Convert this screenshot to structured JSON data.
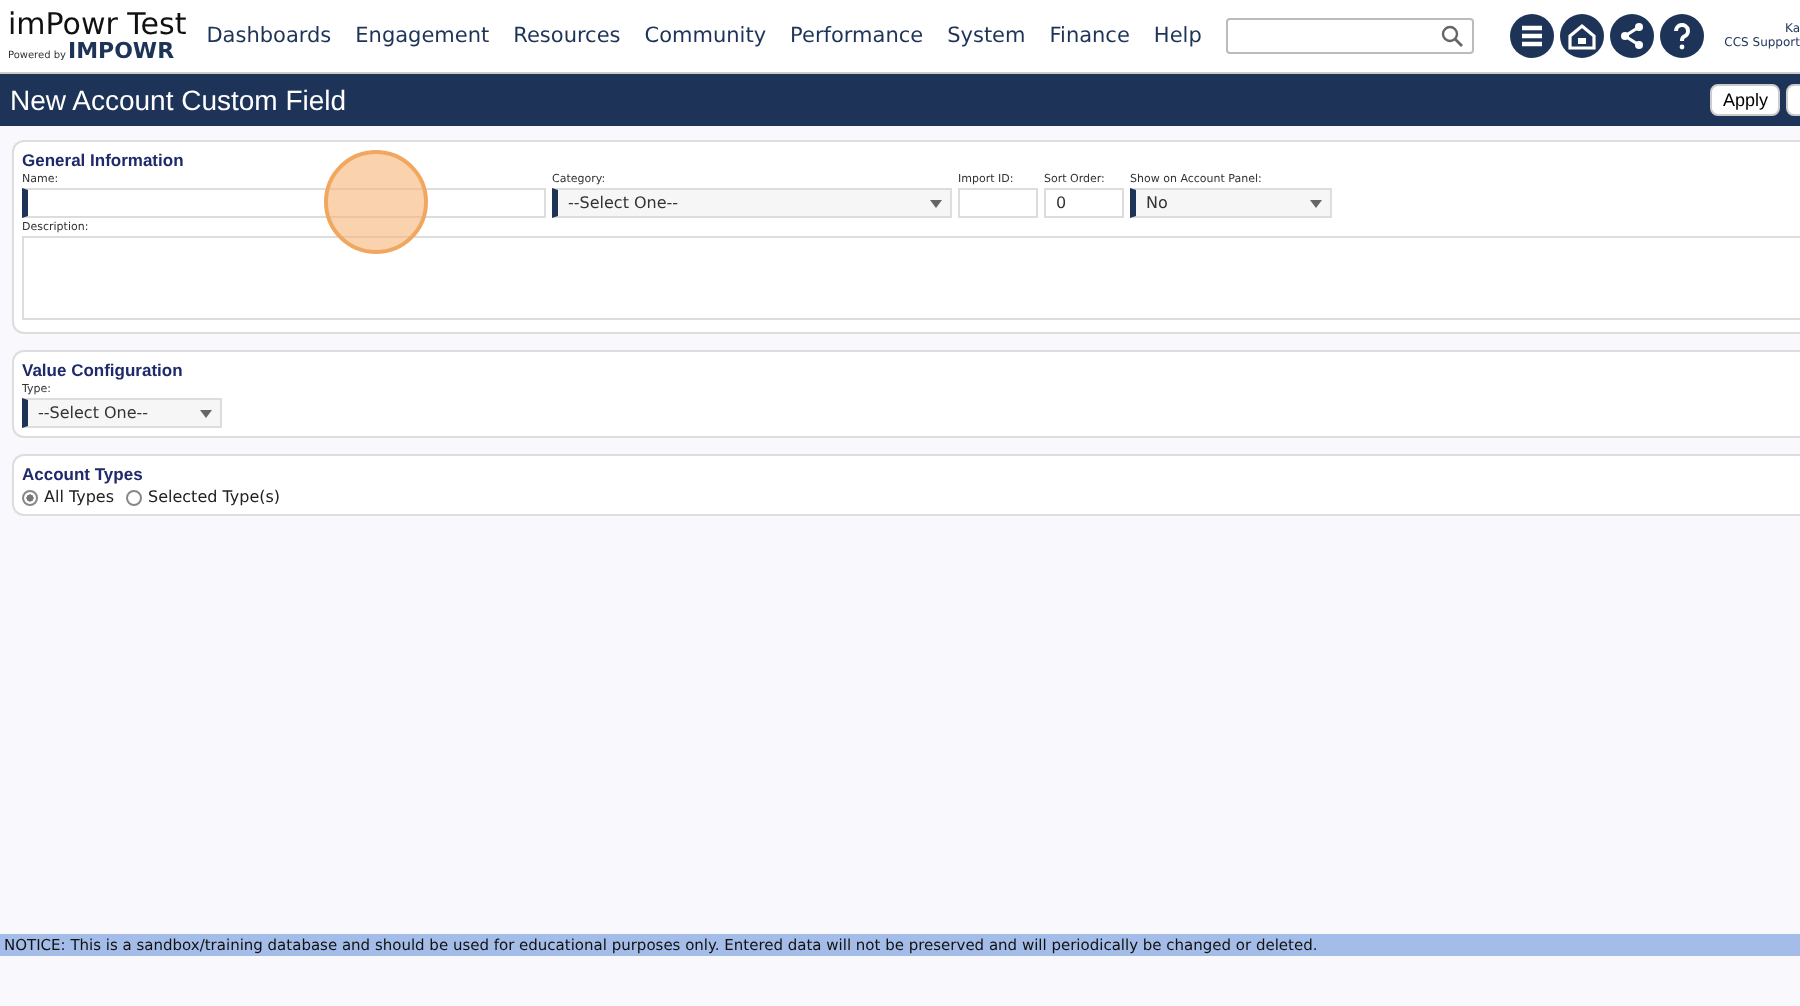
{
  "header": {
    "logo_title": "imPowr Test",
    "logo_powered": "Powered by",
    "logo_brand": "IMPOWR",
    "nav": [
      "Dashboards",
      "Engagement",
      "Resources",
      "Community",
      "Performance",
      "System",
      "Finance",
      "Help"
    ],
    "user": {
      "name": "Ka",
      "org": "CCS Support"
    }
  },
  "title_bar": {
    "title": "New Account Custom Field",
    "buttons": [
      "Apply"
    ]
  },
  "general": {
    "heading": "General Information",
    "fields": [
      {
        "kind": "text",
        "label": "Name:",
        "required": true
      },
      {
        "kind": "select",
        "label": "Category:",
        "value": "--Select One--",
        "required": true
      },
      {
        "kind": "text",
        "label": "Import ID:",
        "required": false
      },
      {
        "kind": "text",
        "label": "Sort Order:",
        "value": "0",
        "required": false
      },
      {
        "kind": "select",
        "label": "Show on Account Panel:",
        "value": "No",
        "required": true
      }
    ],
    "description_label": "Description:"
  },
  "value_config": {
    "heading": "Value Configuration",
    "type_label": "Type:",
    "type_value": "--Select One--"
  },
  "account_types": {
    "heading": "Account Types",
    "options": [
      {
        "label": "All Types",
        "selected": true
      },
      {
        "label": "Selected Type(s)",
        "selected": false
      }
    ]
  },
  "notice": "NOTICE: This is a sandbox/training database and should be used for educational purposes only. Entered data will not be preserved and will periodically be changed or deleted."
}
